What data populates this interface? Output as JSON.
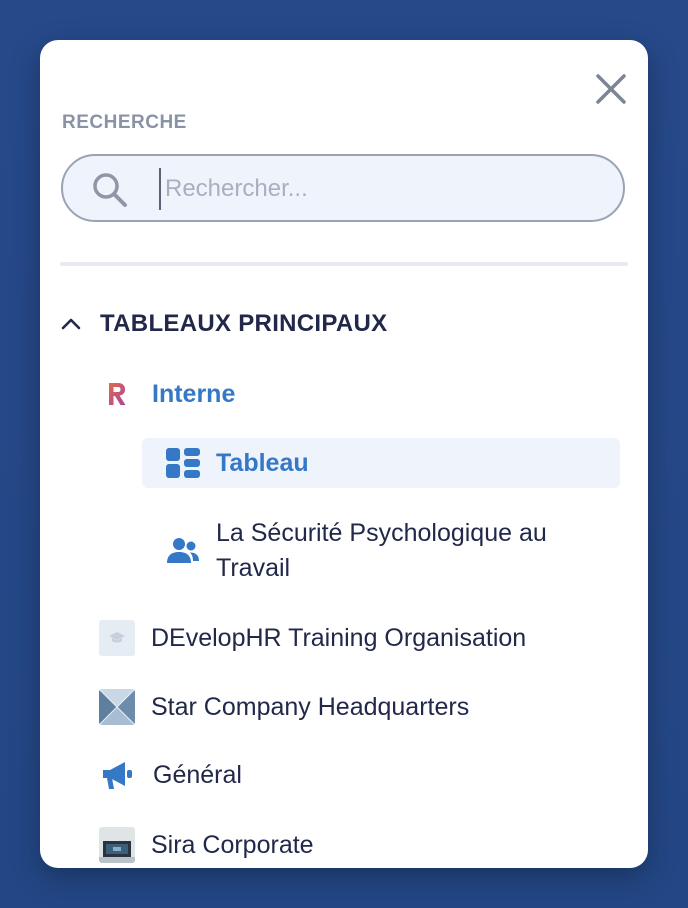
{
  "search": {
    "section_label": "RECHERCHE",
    "placeholder": "Rechercher...",
    "value": ""
  },
  "group": {
    "label": "TABLEAUX PRINCIPAUX",
    "expanded": true
  },
  "items": [
    {
      "label": "Interne",
      "icon": "r-logo-icon",
      "level": 1,
      "active_parent": true
    },
    {
      "label": "Tableau",
      "icon": "dashboard-icon",
      "level": 2,
      "selected": true
    },
    {
      "label_line1": "La Sécurité Psychologique au",
      "label_line2": "Travail",
      "icon": "users-icon",
      "level": 2
    },
    {
      "label": "DEvelopHR Training Organisation",
      "icon": "graduation-cap-icon",
      "level": 1
    },
    {
      "label": "Star Company Headquarters",
      "icon": "building-thumbnail-icon",
      "level": 1
    },
    {
      "label": "Général",
      "icon": "megaphone-icon",
      "level": 1
    },
    {
      "label": "Sira Corporate",
      "icon": "screen-thumbnail-icon",
      "level": 1
    }
  ],
  "colors": {
    "accent": "#3478c6",
    "text": "#22284a",
    "muted": "#8a93a6",
    "backdrop": "#254a8b"
  }
}
